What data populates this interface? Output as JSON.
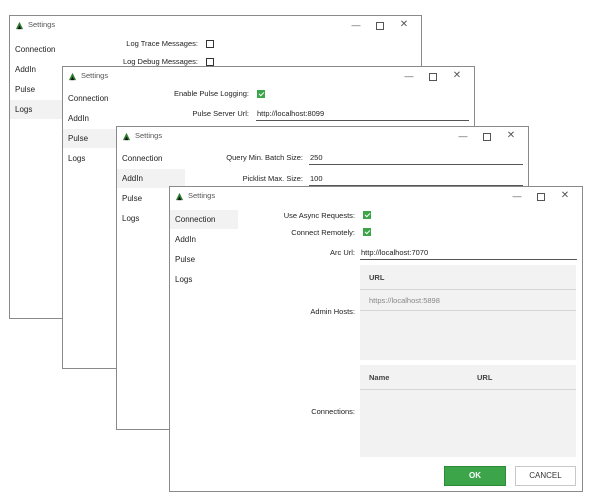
{
  "windows": [
    {
      "title": "Settings",
      "nav": [
        "Connection",
        "AddIn",
        "Pulse",
        "Logs"
      ],
      "selected_nav": 3,
      "fields": [
        {
          "label": "Log Trace Messages:",
          "checked": false
        },
        {
          "label": "Log Debug Messages:",
          "checked": false
        }
      ]
    },
    {
      "title": "Settings",
      "nav": [
        "Connection",
        "AddIn",
        "Pulse",
        "Logs"
      ],
      "selected_nav": 2,
      "fields": [
        {
          "label": "Enable Pulse Logging:",
          "checked": true
        },
        {
          "label": "Pulse Server Url:",
          "value": "http://localhost:8099"
        }
      ]
    },
    {
      "title": "Settings",
      "nav": [
        "Connection",
        "AddIn",
        "Pulse",
        "Logs"
      ],
      "selected_nav": 1,
      "fields": [
        {
          "label": "Query Min. Batch Size:",
          "value": "250"
        },
        {
          "label": "Picklist Max. Size:",
          "value": "100"
        }
      ]
    },
    {
      "title": "Settings",
      "nav": [
        "Connection",
        "AddIn",
        "Pulse",
        "Logs"
      ],
      "selected_nav": 0,
      "fields": [
        {
          "label": "Use Async Requests:",
          "checked": true
        },
        {
          "label": "Connect Remotely:",
          "checked": true
        },
        {
          "label": "Arc Url:",
          "value": "http://localhost:7070"
        }
      ],
      "admin_hosts": {
        "label": "Admin Hosts:",
        "columns": [
          "URL"
        ],
        "placeholder": "https://localhost:5898"
      },
      "connections": {
        "label": "Connections:",
        "columns": [
          "Name",
          "URL"
        ]
      },
      "buttons": {
        "ok": "OK",
        "cancel": "CANCEL"
      }
    }
  ],
  "window_controls": {
    "minimize": "—",
    "close": "✕"
  },
  "colors": {
    "accent": "#3ca54a",
    "selection": "#f2f2f2",
    "grid": "#f2f2f2"
  }
}
